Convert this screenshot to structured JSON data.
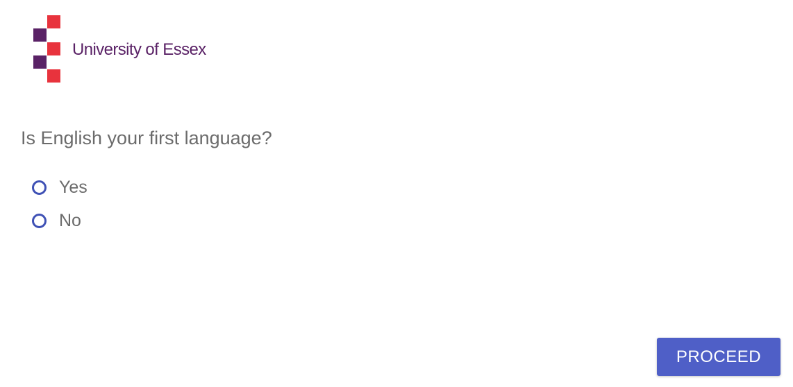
{
  "logo": {
    "text": "University of Essex",
    "colors": {
      "purple": "#5a2266",
      "red": "#e8333d",
      "text": "#5a2266"
    }
  },
  "question": {
    "text": "Is English your first language?"
  },
  "options": [
    {
      "label": "Yes",
      "selected": false
    },
    {
      "label": "No",
      "selected": false
    }
  ],
  "proceed_button": {
    "label": "PROCEED",
    "color": "#4f5fc7"
  },
  "accent_color": "#3f51b5"
}
